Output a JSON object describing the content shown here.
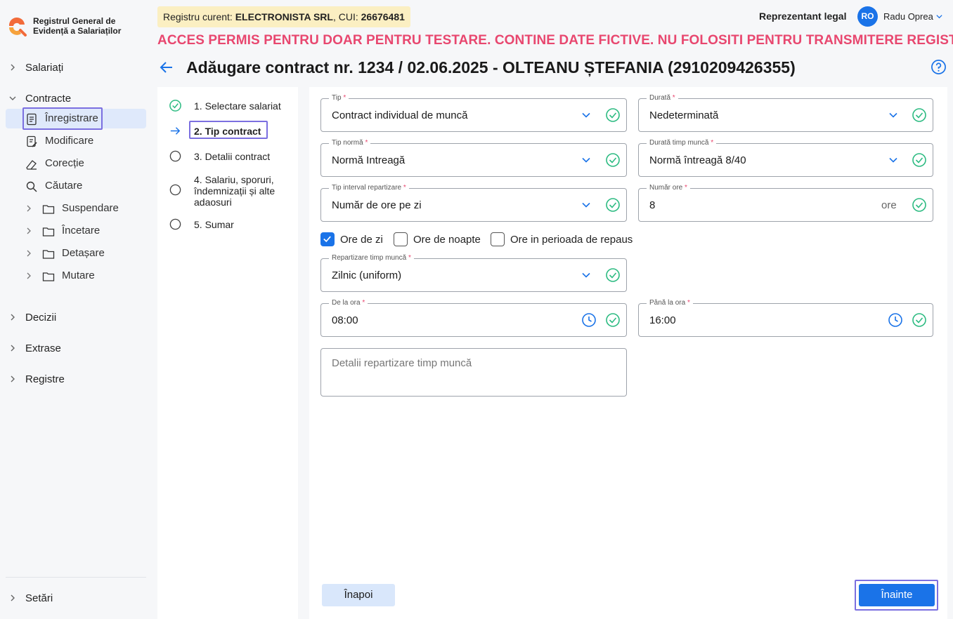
{
  "app": {
    "title_line1": "Registrul General de",
    "title_line2": "Evidență a Salariaților"
  },
  "sidebar": {
    "salariati": "Salariați",
    "contracte": "Contracte",
    "contract_items": [
      {
        "label": "Înregistrare"
      },
      {
        "label": "Modificare"
      },
      {
        "label": "Corecție"
      },
      {
        "label": "Căutare"
      },
      {
        "label": "Suspendare"
      },
      {
        "label": "Încetare"
      },
      {
        "label": "Detașare"
      },
      {
        "label": "Mutare"
      }
    ],
    "decizii": "Decizii",
    "extrase": "Extrase",
    "registre": "Registre",
    "setari": "Setări"
  },
  "header": {
    "registry_prefix": "Registru curent: ",
    "registry_name": "ELECTRONISTA SRL",
    "cui_prefix": ", CUI: ",
    "cui": "26676481",
    "role": "Reprezentant legal",
    "avatar_initials": "RO",
    "username": "Radu Oprea",
    "warning": "ACCES PERMIS PENTRU DOAR PENTRU TESTARE. CONTINE DATE FICTIVE. NU FOLOSITI PENTRU TRANSMITERE REGISTRU",
    "page_title": "Adăugare contract nr. 1234 / 02.06.2025 - OLTEANU  ȘTEFANIA (2910209426355)"
  },
  "steps": [
    {
      "label": "1. Selectare salariat",
      "state": "done"
    },
    {
      "label": "2. Tip contract",
      "state": "current"
    },
    {
      "label": "3. Detalii contract",
      "state": "pending"
    },
    {
      "label_l1": "4. Salariu, sporuri,",
      "label_l2": "îndemnizații și alte",
      "label_l3": "adaosuri",
      "state": "pending"
    },
    {
      "label": "5. Sumar",
      "state": "pending"
    }
  ],
  "form": {
    "tip": {
      "label": "Tip",
      "value": "Contract individual de muncă"
    },
    "durata": {
      "label": "Durată",
      "value": "Nedeterminată"
    },
    "tip_norma": {
      "label": "Tip normă",
      "value": "Normă Intreagă"
    },
    "durata_timp": {
      "label": "Durată timp muncă",
      "value": "Normă întreagă 8/40"
    },
    "tip_interval": {
      "label": "Tip interval repartizare",
      "value": "Număr de ore pe zi"
    },
    "numar_ore": {
      "label": "Număr ore",
      "value": "8",
      "unit": "ore"
    },
    "checkboxes": [
      {
        "label": "Ore de zi",
        "checked": true
      },
      {
        "label": "Ore de noapte",
        "checked": false
      },
      {
        "label": "Ore in perioada de repaus",
        "checked": false
      }
    ],
    "repartizare": {
      "label": "Repartizare timp muncă",
      "value": "Zilnic (uniform)"
    },
    "de_la_ora": {
      "label": "De la ora",
      "value": "08:00"
    },
    "pana_la_ora": {
      "label": "Până la ora",
      "value": "16:00"
    },
    "detalii_placeholder": "Detalii repartizare timp muncă",
    "required_mark": "*"
  },
  "buttons": {
    "back": "Înapoi",
    "next": "Înainte"
  },
  "colors": {
    "accent": "#1a73e8",
    "success": "#2dbb82",
    "warning_text": "#e8476f",
    "highlight_border": "#7b6fe0",
    "registry_bg": "#fbefc2"
  }
}
